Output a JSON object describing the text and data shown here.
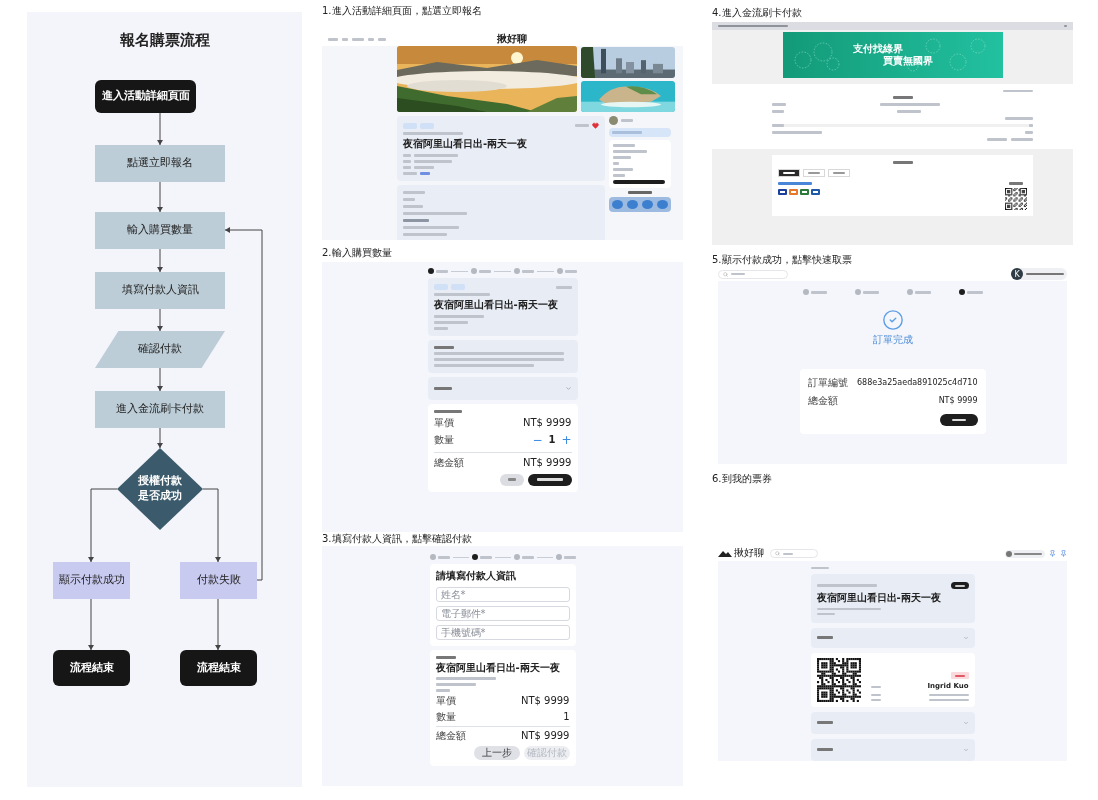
{
  "flowchart": {
    "title": "報名購票流程",
    "nodes": [
      {
        "kind": "terminal",
        "label": "進入活動詳細頁面"
      },
      {
        "kind": "process",
        "label": "點選立即報名"
      },
      {
        "kind": "process",
        "label": "輸入購買數量"
      },
      {
        "kind": "process",
        "label": "填寫付款人資訊"
      },
      {
        "kind": "io",
        "label": "確認付款"
      },
      {
        "kind": "process",
        "label": "進入金流刷卡付款"
      },
      {
        "kind": "decision",
        "label": "授權付款是否成功"
      },
      {
        "kind": "result",
        "label": "顯示付款成功"
      },
      {
        "kind": "result",
        "label": "付款失敗"
      },
      {
        "kind": "terminal",
        "label": "流程結束"
      },
      {
        "kind": "terminal",
        "label": "流程結束"
      }
    ]
  },
  "event_page": {
    "caption": "1.進入活動詳細頁面，點選立即報名",
    "brand": "揪好聊",
    "title": "夜宿阿里山看日出-兩天一夜"
  },
  "quantity_page": {
    "caption": "2.輸入購買數量",
    "steps": [
      {
        "selected": true
      },
      {
        "selected": false
      },
      {
        "selected": false
      },
      {
        "selected": false
      }
    ],
    "title": "夜宿阿里山看日出-兩天一夜",
    "rows": [
      {
        "label": "單價",
        "value": "NT$ 9999"
      }
    ],
    "quantity": {
      "label": "數量",
      "minus": "−",
      "value": "1",
      "plus": "+"
    },
    "total": {
      "label": "總金額",
      "value": "NT$ 9999"
    }
  },
  "payer_page": {
    "caption": "3.填寫付款人資訊，點擊確認付款",
    "steps": [
      {
        "selected": false
      },
      {
        "selected": true
      },
      {
        "selected": false
      },
      {
        "selected": false
      }
    ],
    "form_title": "請填寫付款人資訊",
    "fields": [
      {
        "placeholder": "姓名*"
      },
      {
        "placeholder": "電子郵件*"
      },
      {
        "placeholder": "手機號碼*"
      }
    ],
    "title": "夜宿阿里山看日出-兩天一夜",
    "rows": [
      {
        "label": "單價",
        "value": "NT$ 9999"
      },
      {
        "label": "數量",
        "value": "1"
      }
    ],
    "total": {
      "label": "總金額",
      "value": "NT$ 9999"
    },
    "buttons": [
      {
        "label": "上一步",
        "disabled": false
      },
      {
        "label": "確認付款",
        "disabled": true
      }
    ]
  },
  "payment_page": {
    "caption": "4.進入金流刷卡付款",
    "banner": [
      "支付找綠界",
      "買賣無國界"
    ],
    "tabs": [
      {
        "selected": true
      },
      {
        "selected": false
      },
      {
        "selected": false
      }
    ]
  },
  "success_page": {
    "caption": "5.顯示付款成功，點擊快速取票",
    "avatar": "K",
    "steps": [
      {
        "selected": false
      },
      {
        "selected": false
      },
      {
        "selected": false
      },
      {
        "selected": true
      }
    ],
    "status": "訂單完成",
    "rows": [
      {
        "label": "訂單編號",
        "value": "688e3a25aeda891025c4d710"
      },
      {
        "label": "總金額",
        "value": "NT$ 9999"
      }
    ]
  },
  "ticket_page": {
    "caption": "6.到我的票券",
    "brand": "揪好聊",
    "title": "夜宿阿里山看日出-兩天一夜",
    "holder": "Ingrid Kuo"
  }
}
